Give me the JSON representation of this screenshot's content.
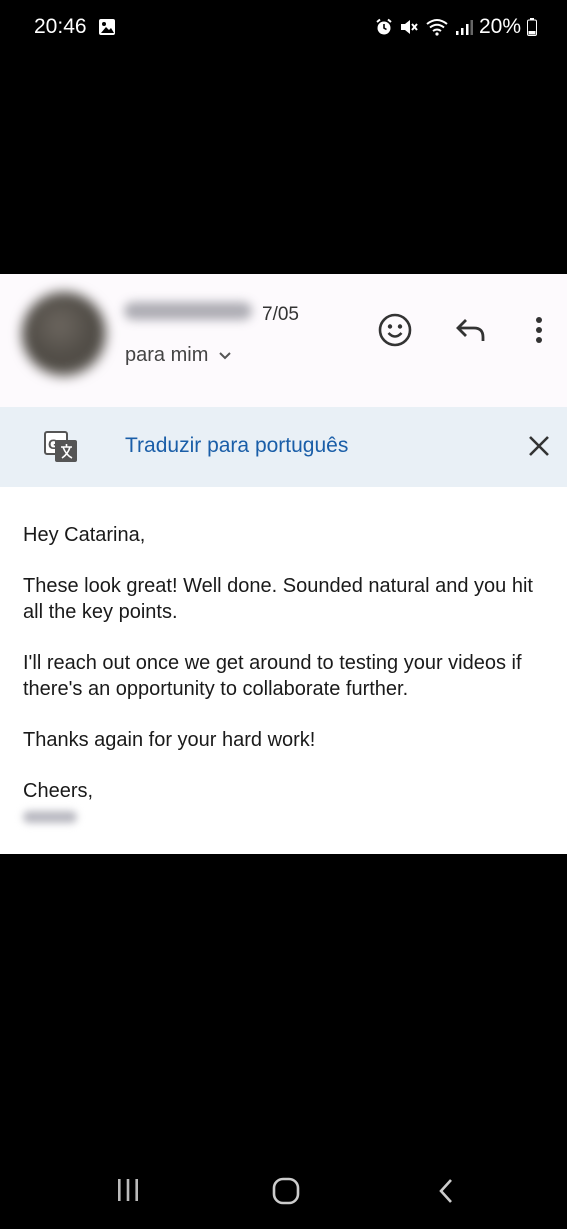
{
  "status_bar": {
    "time": "20:46",
    "battery": "20%",
    "icons": [
      "gallery-icon",
      "alarm-icon",
      "mute-icon",
      "wifi-icon",
      "signal-icon",
      "battery-icon"
    ]
  },
  "email": {
    "sender_name": "Harry",
    "date": "7/05",
    "recipient": "para mim",
    "translate_label": "Traduzir para português",
    "greeting": "Hey Catarina,",
    "paragraph1": "These look great! Well done. Sounded natural and you hit all the key points.",
    "paragraph2": "I'll reach out once we get around to testing your videos if there's an opportunity to collaborate further.",
    "paragraph3": "Thanks again for your hard work!",
    "closing": "Cheers,",
    "signature": "Harry"
  },
  "colors": {
    "link_blue": "#1a5ea8",
    "translate_bg": "#e9f0f6"
  },
  "nav_bar": {
    "icons": [
      "recent-apps-icon",
      "home-icon",
      "back-icon"
    ]
  }
}
